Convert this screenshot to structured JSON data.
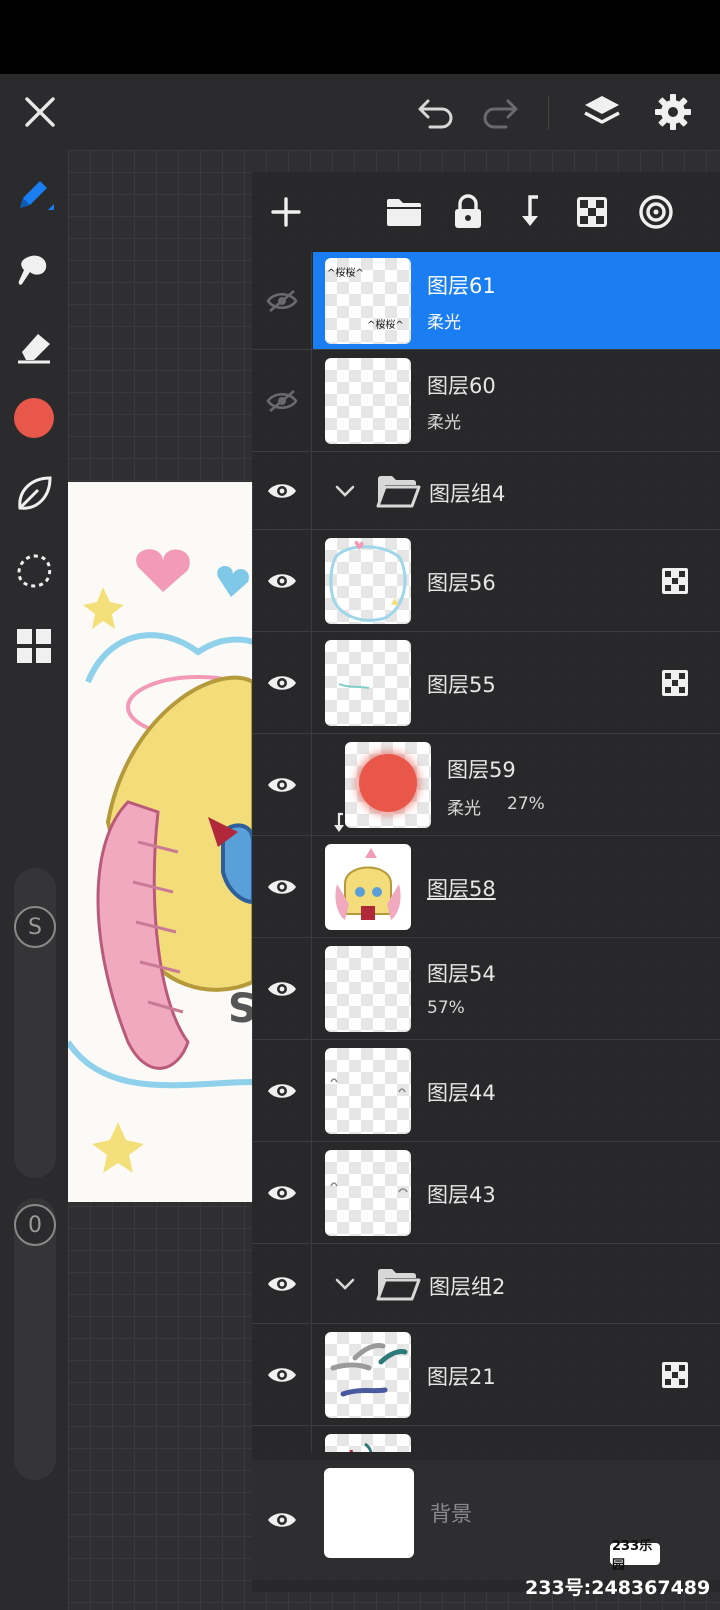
{
  "topbar": {
    "close_icon": "close-icon",
    "undo_icon": "undo-icon",
    "redo_icon": "redo-icon",
    "layers_icon": "layers-icon",
    "settings_icon": "gear-icon"
  },
  "toolbar": {
    "tools": [
      "pen-icon",
      "smudge-icon",
      "eraser-icon",
      "color-swatch",
      "leaf-icon",
      "lasso-icon",
      "grid-icon"
    ],
    "active_color": "#e8574a",
    "accent": "#1a7ef2",
    "size_slider_label": "S",
    "opacity_slider_label": "0"
  },
  "panel": {
    "actions": [
      "add-icon",
      "folder-icon",
      "lock-icon",
      "merge-down-icon",
      "mask-icon",
      "blend-icon"
    ]
  },
  "layers": [
    {
      "name": "图层61",
      "sub": "柔光",
      "visible": false,
      "selected": true,
      "type": "layer",
      "thumb_text_a": "^桜桜^",
      "thumb_text_b": "^桜桜^"
    },
    {
      "name": "图层60",
      "sub": "柔光",
      "visible": false,
      "type": "layer"
    },
    {
      "name": "图层组4",
      "visible": true,
      "type": "group"
    },
    {
      "name": "图层56",
      "visible": true,
      "type": "layer",
      "mask": true
    },
    {
      "name": "图层55",
      "visible": true,
      "type": "layer",
      "mask": true
    },
    {
      "name": "图层59",
      "sub_blend": "柔光",
      "sub_opacity": "27%",
      "visible": true,
      "type": "clipped"
    },
    {
      "name": "图层58",
      "visible": true,
      "type": "layer"
    },
    {
      "name": "图层54",
      "sub": "57%",
      "visible": true,
      "type": "layer"
    },
    {
      "name": "图层44",
      "visible": true,
      "type": "layer"
    },
    {
      "name": "图层43",
      "visible": true,
      "type": "layer"
    },
    {
      "name": "图层组2",
      "visible": true,
      "type": "group"
    },
    {
      "name": "图层21",
      "visible": true,
      "type": "layer",
      "mask": true
    }
  ],
  "background_layer": {
    "name": "背景"
  },
  "watermark": {
    "badge": "233乐园",
    "text": "233号:248367489"
  }
}
